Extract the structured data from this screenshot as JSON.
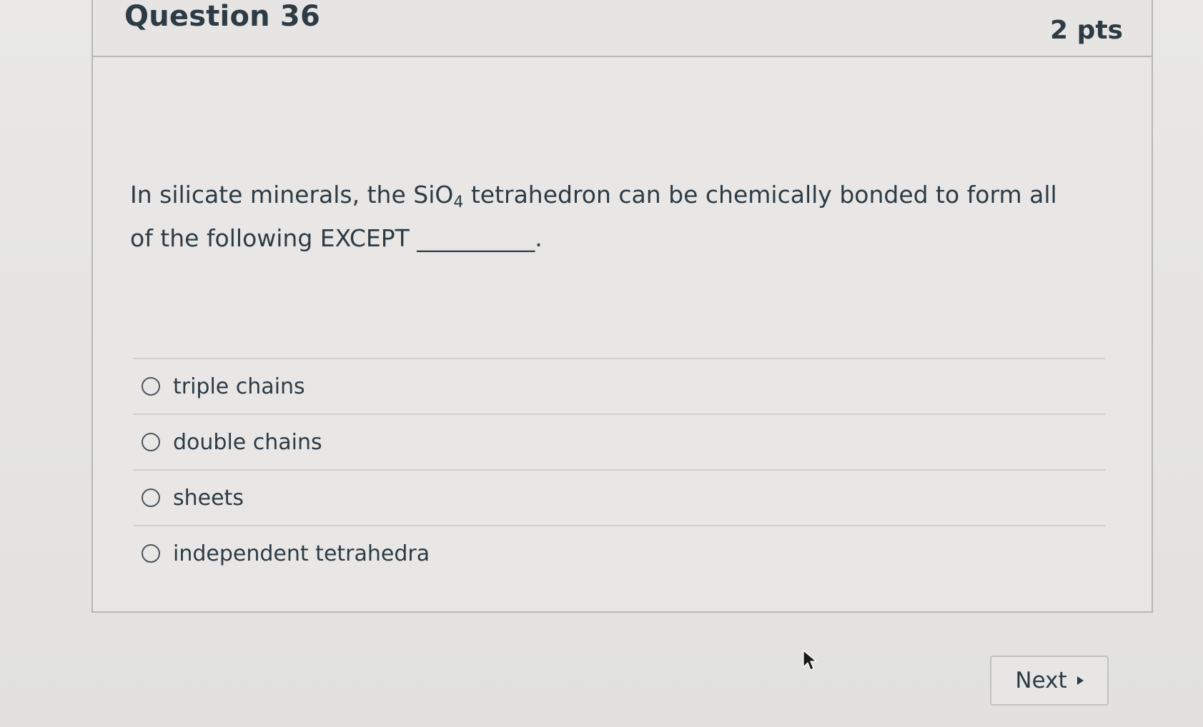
{
  "question": {
    "title": "Question 36",
    "points": "2 pts",
    "text_before": "In silicate minerals, the SiO",
    "text_subscript": "4",
    "text_after": " tetrahedron can be chemically bonded to form all of the following EXCEPT __________."
  },
  "answers": [
    {
      "label": "triple chains",
      "selected": false
    },
    {
      "label": "double chains",
      "selected": false
    },
    {
      "label": "sheets",
      "selected": false
    },
    {
      "label": "independent tetrahedra",
      "selected": false
    }
  ],
  "navigation": {
    "next_label": "Next",
    "next_icon": "caret-right-icon"
  },
  "colors": {
    "text": "#2d3b45",
    "background": "#e8e7e5",
    "divider": "#cfcfcd"
  }
}
